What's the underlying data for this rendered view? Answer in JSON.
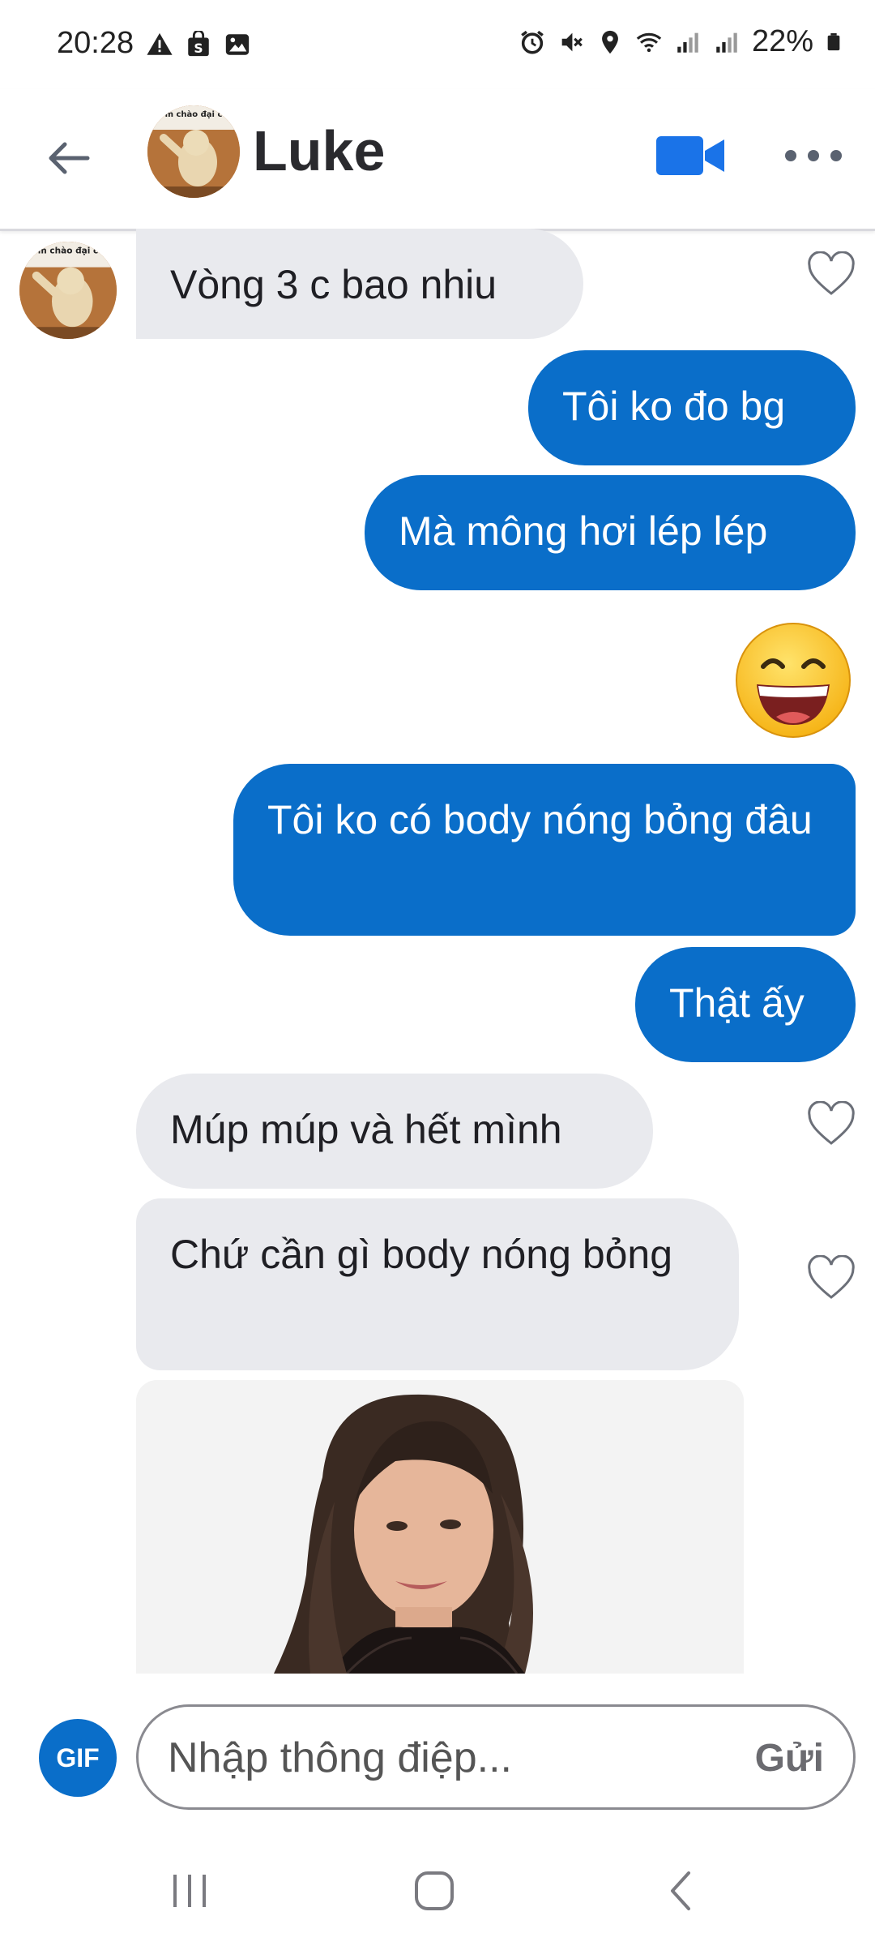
{
  "status_bar": {
    "time": "20:28",
    "battery": "22%",
    "icons_left": [
      "warning-icon",
      "shop-icon",
      "image-icon"
    ],
    "icons_right": [
      "alarm-icon",
      "mute-icon",
      "location-icon",
      "wifi-icon",
      "signal-icon",
      "signal-icon",
      "battery-icon"
    ]
  },
  "header": {
    "title": "Luke",
    "avatar_caption": "m chào đại c",
    "video_icon": "video-camera-icon",
    "more_icon": "more-dots-icon"
  },
  "messages": [
    {
      "side": "in",
      "text": "Vòng 3 c bao nhiu"
    },
    {
      "side": "out",
      "text": "Tôi ko đo bg"
    },
    {
      "side": "out",
      "text": "Mà mông hơi lép lép"
    },
    {
      "side": "out",
      "emoji": "grinning-emoji"
    },
    {
      "side": "out",
      "text": "Tôi ko có body nóng bỏng đâu"
    },
    {
      "side": "out",
      "text": "Thật ấy"
    },
    {
      "side": "in",
      "text": "Múp múp và hết mình"
    },
    {
      "side": "in",
      "text": "Chứ cần gì body nóng bỏng"
    },
    {
      "side": "in",
      "image": "woman-portrait-photo"
    }
  ],
  "composer": {
    "gif_label": "GIF",
    "placeholder": "Nhập thông điệp...",
    "send_label": "Gửi"
  },
  "colors": {
    "accent": "#0a6ec9",
    "incoming_bubble": "#e9eaee"
  }
}
